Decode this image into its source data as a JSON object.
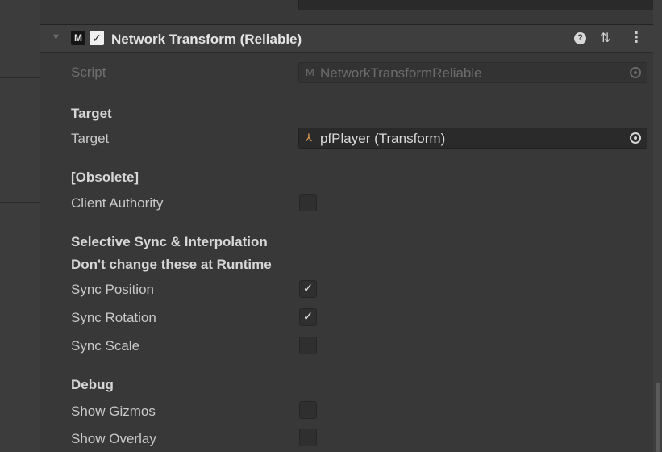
{
  "header": {
    "title": "Network Transform (Reliable)",
    "enabled": true,
    "foldout_icon": "triangle-down-icon",
    "component_icon": "mirror-component-icon",
    "help_icon": "help-icon",
    "presets_icon": "presets-icon",
    "menu_icon": "kebab-menu-icon"
  },
  "script": {
    "label": "Script",
    "value": "NetworkTransformReliable"
  },
  "target_section": {
    "heading": "Target",
    "label": "Target",
    "value": "pfPlayer (Transform)"
  },
  "obsolete_section": {
    "heading": "[Obsolete]",
    "client_authority_label": "Client Authority",
    "client_authority": false
  },
  "sync_section": {
    "heading_line1": "Selective Sync & Interpolation",
    "heading_line2": "Don't change these at Runtime",
    "sync_position_label": "Sync Position",
    "sync_position": true,
    "sync_rotation_label": "Sync Rotation",
    "sync_rotation": true,
    "sync_scale_label": "Sync Scale",
    "sync_scale": false
  },
  "debug_section": {
    "heading": "Debug",
    "show_gizmos_label": "Show Gizmos",
    "show_gizmos": false,
    "show_overlay_label": "Show Overlay",
    "show_overlay": false
  },
  "colors": {
    "background": "#383838",
    "header": "#3e3e3e",
    "field": "#2a2a2a",
    "text": "#c8c8c8"
  },
  "check_glyph": "✓"
}
